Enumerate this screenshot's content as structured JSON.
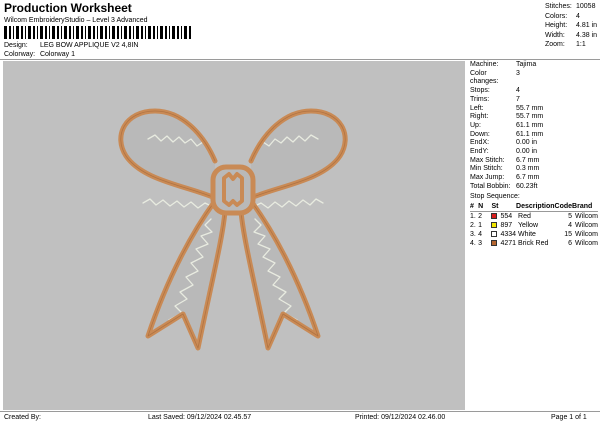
{
  "header": {
    "title": "Production Worksheet",
    "subtitle": "Wilcom EmbroideryStudio – Level 3 Advanced",
    "design_label": "Design:",
    "design_value": "LEG BOW APPLIQUE V2 4,8IN",
    "colorway_label": "Colorway:",
    "colorway_value": "Colorway 1"
  },
  "stats": {
    "stitches": {
      "label": "Stitches:",
      "value": "10058"
    },
    "colors": {
      "label": "Colors:",
      "value": "4"
    },
    "height": {
      "label": "Height:",
      "value": "4.81 in"
    },
    "width": {
      "label": "Width:",
      "value": "4.38 in"
    },
    "zoom": {
      "label": "Zoom:",
      "value": "1:1"
    }
  },
  "machine_info": [
    {
      "label": "Machine:",
      "value": "Tajima"
    },
    {
      "label": "Color changes:",
      "value": "3"
    },
    {
      "label": "Stops:",
      "value": "4"
    },
    {
      "label": "Trims:",
      "value": "7"
    },
    {
      "label": "Left:",
      "value": "55.7 mm"
    },
    {
      "label": "Right:",
      "value": "55.7 mm"
    },
    {
      "label": "Up:",
      "value": "61.1 mm"
    },
    {
      "label": "Down:",
      "value": "61.1 mm"
    },
    {
      "label": "EndX:",
      "value": "0.00 in"
    },
    {
      "label": "EndY:",
      "value": "0.00 in"
    },
    {
      "label": "Max Stitch:",
      "value": "6.7 mm"
    },
    {
      "label": "Min Stitch:",
      "value": "0.3 mm"
    },
    {
      "label": "Max Jump:",
      "value": "6.7 mm"
    },
    {
      "label": "Total Bobbin:",
      "value": "60.23ft"
    }
  ],
  "stop_sequence": {
    "title": "Stop Sequence:",
    "headers": [
      "#",
      "N",
      "St",
      "Description",
      "Code",
      "Brand"
    ],
    "rows": [
      {
        "num": "1.",
        "n": "2",
        "color": "#d81e1e",
        "st": "554",
        "description": "Red",
        "code": "5",
        "brand": "Wilcom"
      },
      {
        "num": "2.",
        "n": "1",
        "color": "#f2e600",
        "st": "897",
        "description": "Yellow",
        "code": "4",
        "brand": "Wilcom"
      },
      {
        "num": "3.",
        "n": "4",
        "color": "#ffffff",
        "st": "4334",
        "description": "White",
        "code": "15",
        "brand": "Wilcom"
      },
      {
        "num": "4.",
        "n": "3",
        "color": "#b5652e",
        "st": "4271",
        "description": "Brick Red",
        "code": "6",
        "brand": "Wilcom"
      }
    ]
  },
  "footer": {
    "created_by": "Created By:",
    "last_saved": "Last Saved: 09/12/2024 02.45.57",
    "printed": "Printed: 09/12/2024 02.46.00",
    "page": "Page 1 of 1"
  },
  "colors": {
    "canvas_bg": "#c0c0c0",
    "outline": "#c98a55",
    "outline_dark": "#a76a3a",
    "interior": "#b9b9b9",
    "stitch": "#e8ebe0"
  }
}
